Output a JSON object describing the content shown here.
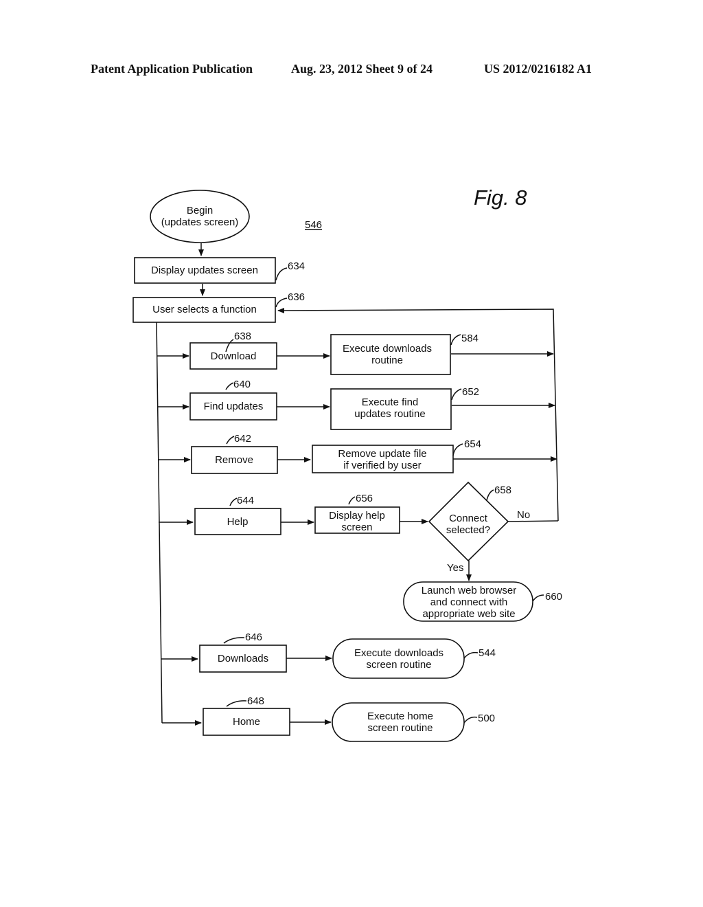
{
  "header": {
    "publication": "Patent Application Publication",
    "date_sheet": "Aug. 23, 2012  Sheet 9 of 24",
    "number": "US 2012/0216182 A1"
  },
  "figure": {
    "title": "Fig. 8",
    "ref": "546"
  },
  "nodes": {
    "begin": {
      "lines": [
        "Begin",
        "(updates screen)"
      ]
    },
    "display_updates": {
      "lines": [
        "Display updates screen"
      ],
      "ref": "634"
    },
    "user_selects": {
      "lines": [
        "User selects a function"
      ],
      "ref": "636"
    },
    "download": {
      "lines": [
        "Download"
      ],
      "ref": "638"
    },
    "exec_downloads": {
      "lines": [
        "Execute downloads",
        "routine"
      ],
      "ref": "584"
    },
    "find_updates": {
      "lines": [
        "Find updates"
      ],
      "ref": "640"
    },
    "exec_find": {
      "lines": [
        "Execute find",
        "updates routine"
      ],
      "ref": "652"
    },
    "remove": {
      "lines": [
        "Remove"
      ],
      "ref": "642"
    },
    "remove_file": {
      "lines": [
        "Remove update file",
        "if verified by user"
      ],
      "ref": "654"
    },
    "help": {
      "lines": [
        "Help"
      ],
      "ref": "644"
    },
    "display_help": {
      "lines": [
        "Display help",
        "screen"
      ],
      "ref": "656"
    },
    "connect": {
      "lines": [
        "Connect",
        "selected?"
      ],
      "ref": "658",
      "yes": "Yes",
      "no": "No"
    },
    "launch": {
      "lines": [
        "Launch web browser",
        "and connect with",
        "appropriate web site"
      ],
      "ref": "660"
    },
    "downloads": {
      "lines": [
        "Downloads"
      ],
      "ref": "646"
    },
    "exec_dl_screen": {
      "lines": [
        "Execute downloads",
        "screen routine"
      ],
      "ref": "544"
    },
    "home": {
      "lines": [
        "Home"
      ],
      "ref": "648"
    },
    "exec_home": {
      "lines": [
        "Execute home",
        "screen routine"
      ],
      "ref": "500"
    }
  }
}
